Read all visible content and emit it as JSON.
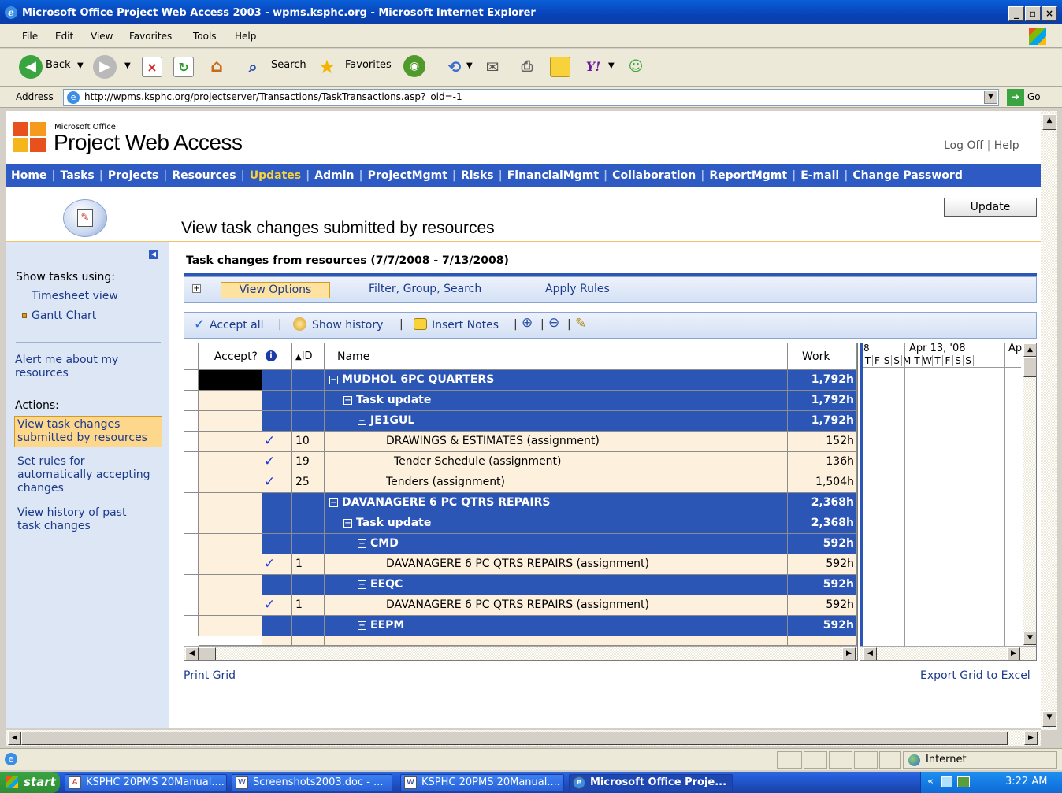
{
  "window": {
    "title": "Microsoft Office Project Web Access 2003 - wpms.ksphc.org - Microsoft Internet Explorer",
    "min": "_",
    "max": "▫",
    "close": "×"
  },
  "menu": [
    "File",
    "Edit",
    "View",
    "Favorites",
    "Tools",
    "Help"
  ],
  "toolbar": {
    "back": "Back",
    "search": "Search",
    "favorites": "Favorites"
  },
  "address": {
    "label": "Address",
    "url": "http://wpms.ksphc.org/projectserver/Transactions/TaskTransactions.asp?_oid=-1",
    "go": "Go"
  },
  "app": {
    "brand_small": "Microsoft Office",
    "brand": "Project Web Access",
    "logoff": "Log Off",
    "help": "Help"
  },
  "nav": [
    "Home",
    "Tasks",
    "Projects",
    "Resources",
    "Updates",
    "Admin",
    "ProjectMgmt",
    "Risks",
    "FinancialMgmt",
    "Collaboration",
    "ReportMgmt",
    "E-mail",
    "Change Password"
  ],
  "nav_active": "Updates",
  "page": {
    "title": "View task changes submitted by resources",
    "update_button": "Update",
    "subtitle": "Task changes from resources (7/7/2008 - 7/13/2008)"
  },
  "sidebar": {
    "show_tasks": "Show tasks using:",
    "timesheet": "Timesheet view",
    "gantt": "Gantt Chart",
    "alert": "Alert me about my resources",
    "actions": "Actions:",
    "view_changes": "View task changes submitted by resources",
    "set_rules": "Set rules for automatically accepting changes",
    "view_history": "View history of past task changes"
  },
  "options_bar": {
    "view_options": "View Options",
    "filter": "Filter, Group, Search",
    "apply_rules": "Apply Rules"
  },
  "actions_bar": {
    "accept_all": "Accept all",
    "show_history": "Show history",
    "insert_notes": "Insert Notes"
  },
  "grid": {
    "headers": {
      "accept": "Accept?",
      "id": "ID",
      "name": "Name",
      "work": "Work"
    },
    "rows": [
      {
        "type": "summary",
        "indent": 0,
        "id": "",
        "name": "MUDHOL 6PC QUARTERS",
        "work": "1,792h",
        "checked": false,
        "selected": true
      },
      {
        "type": "summary",
        "indent": 1,
        "id": "",
        "name": "Task update",
        "work": "1,792h",
        "checked": false
      },
      {
        "type": "summary",
        "indent": 2,
        "id": "",
        "name": "JE1GUL",
        "work": "1,792h",
        "checked": false
      },
      {
        "type": "assignment",
        "indent": 3,
        "id": "10",
        "name": "DRAWINGS & ESTIMATES (assignment)",
        "work": "152h",
        "checked": true
      },
      {
        "type": "assignment",
        "indent": 4,
        "id": "19",
        "name": "Tender Schedule (assignment)",
        "work": "136h",
        "checked": true
      },
      {
        "type": "assignment",
        "indent": 3,
        "id": "25",
        "name": "Tenders (assignment)",
        "work": "1,504h",
        "checked": true
      },
      {
        "type": "summary",
        "indent": 0,
        "id": "",
        "name": "DAVANAGERE  6 PC QTRS REPAIRS",
        "work": "2,368h",
        "checked": false
      },
      {
        "type": "summary",
        "indent": 1,
        "id": "",
        "name": "Task update",
        "work": "2,368h",
        "checked": false
      },
      {
        "type": "summary",
        "indent": 2,
        "id": "",
        "name": "CMD",
        "work": "592h",
        "checked": false
      },
      {
        "type": "assignment",
        "indent": 3,
        "id": "1",
        "name": "DAVANAGERE  6 PC QTRS REPAIRS (assignment)",
        "work": "592h",
        "checked": true
      },
      {
        "type": "summary",
        "indent": 2,
        "id": "",
        "name": "EEQC",
        "work": "592h",
        "checked": false
      },
      {
        "type": "assignment",
        "indent": 3,
        "id": "1",
        "name": "DAVANAGERE  6 PC QTRS REPAIRS (assignment)",
        "work": "592h",
        "checked": true
      },
      {
        "type": "summary",
        "indent": 2,
        "id": "",
        "name": "EEPM",
        "work": "592h",
        "checked": false
      }
    ]
  },
  "gantt": {
    "week_label": "Apr 13, '08",
    "days": [
      "T",
      "F",
      "S",
      "S",
      "M",
      "T",
      "W",
      "T",
      "F",
      "S",
      "S"
    ],
    "next_label": "Ap"
  },
  "footer": {
    "print_grid": "Print Grid",
    "export": "Export Grid to Excel"
  },
  "statusbar": {
    "zone": "Internet"
  },
  "taskbar": {
    "start": "start",
    "items": [
      "KSPHC 20PMS 20Manual....",
      "Screenshots2003.doc - ...",
      "KSPHC 20PMS 20Manual....",
      "Microsoft Office Proje..."
    ],
    "clock": "3:22 AM"
  }
}
